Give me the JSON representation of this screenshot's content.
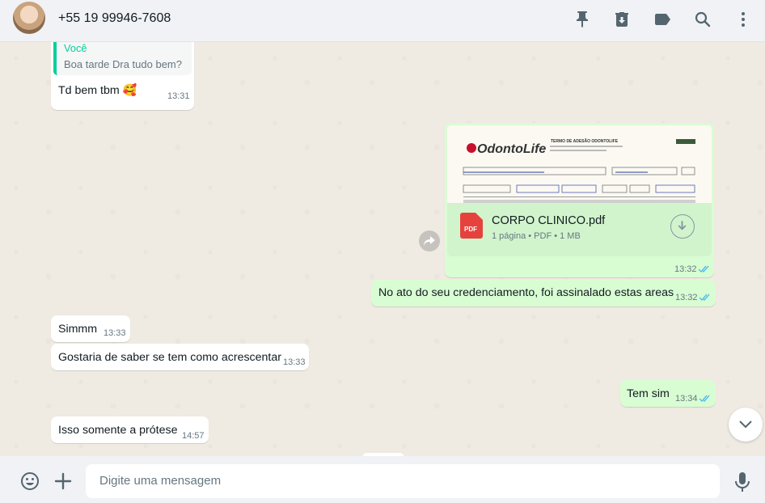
{
  "header": {
    "contact_name": "+55 19 99946-7608",
    "icons": [
      "pin-icon",
      "archive-icon",
      "label-icon",
      "search-icon",
      "menu-icon"
    ]
  },
  "messages": [
    {
      "direction": "in",
      "quoted_author": "Você",
      "quoted_text": "Boa tarde Dra tudo bem?",
      "text": "Td bem tbm 🥰",
      "time": "13:31"
    },
    {
      "direction": "out",
      "type": "document",
      "file_name": "CORPO CLINICO.pdf",
      "file_type_badge": "PDF",
      "file_meta": "1 página • PDF • 1 MB",
      "preview_brand": "OdontoLife",
      "preview_heading": "TERMO DE ADESÃO ODONTOLIFE",
      "time": "13:32",
      "status": "read"
    },
    {
      "direction": "out",
      "text": "No ato do seu credenciamento, foi assinalado estas areas",
      "time": "13:32",
      "status": "read"
    },
    {
      "direction": "in",
      "text": "Simmm",
      "time": "13:33"
    },
    {
      "direction": "in",
      "text": "Gostaria de saber se tem como acrescentar",
      "time": "13:33"
    },
    {
      "direction": "out",
      "text": "Tem sim",
      "time": "13:34",
      "status": "read"
    },
    {
      "direction": "in",
      "text": "Isso somente a prótese",
      "time": "14:57"
    }
  ],
  "composer": {
    "placeholder": "Digite uma mensagem",
    "icons": [
      "emoji-icon",
      "attach-plus-icon",
      "microphone-icon"
    ]
  },
  "colors": {
    "accent": "#06cf9c",
    "outgoing": "#d9fdd3",
    "incoming": "#ffffff",
    "read_ticks": "#53bdeb"
  }
}
